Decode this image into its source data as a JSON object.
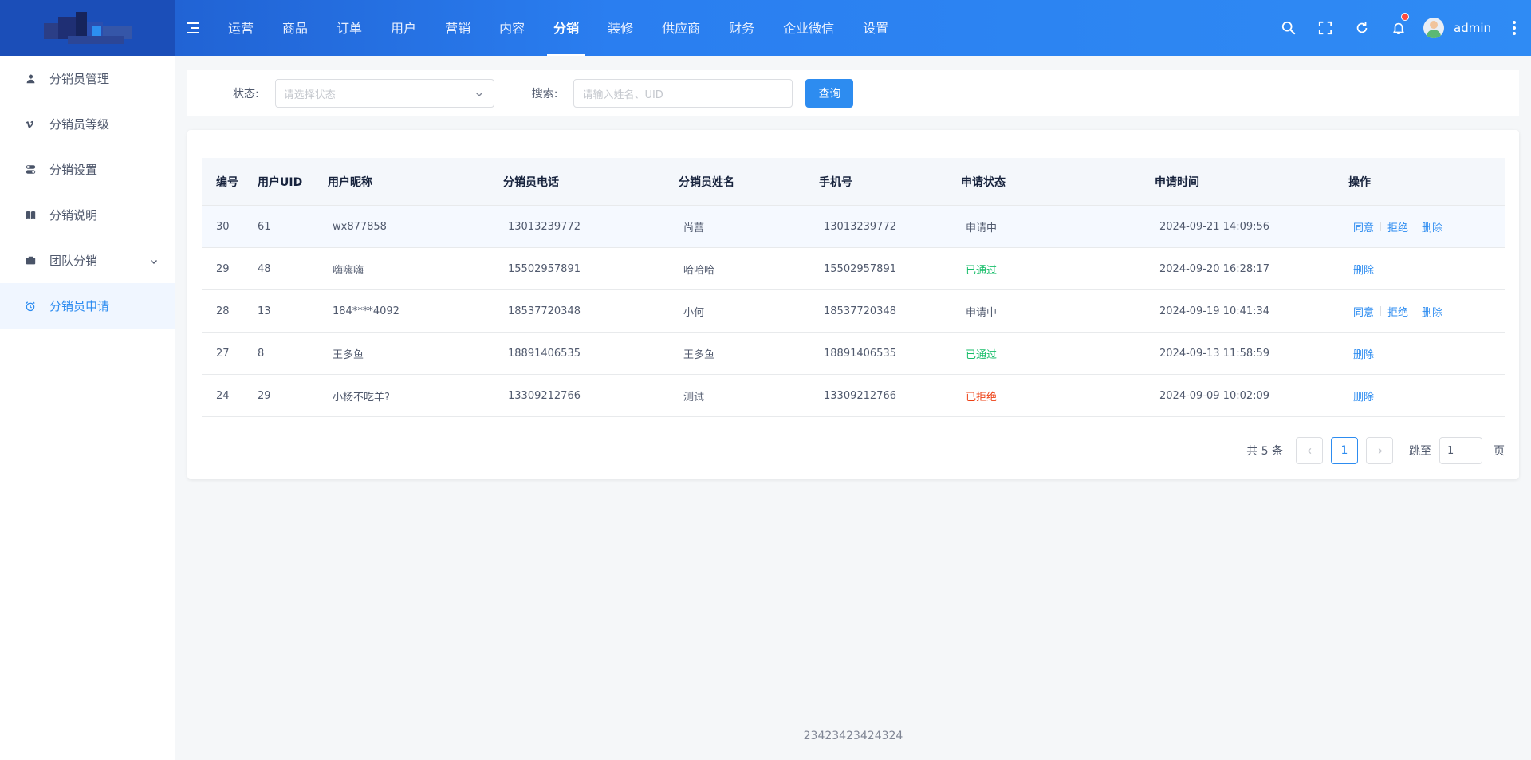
{
  "header": {
    "nav": [
      "运营",
      "商品",
      "订单",
      "用户",
      "营销",
      "内容",
      "分销",
      "装修",
      "供应商",
      "财务",
      "企业微信",
      "设置"
    ],
    "active_nav": "分销",
    "username": "admin"
  },
  "sidebar": {
    "items": [
      {
        "label": "分销员管理",
        "icon": "user-icon"
      },
      {
        "label": "分销员等级",
        "icon": "vimeo-v-icon"
      },
      {
        "label": "分销设置",
        "icon": "toggle-icon"
      },
      {
        "label": "分销说明",
        "icon": "book-icon"
      },
      {
        "label": "团队分销",
        "icon": "briefcase-icon"
      },
      {
        "label": "分销员申请",
        "icon": "alarm-clock-icon"
      }
    ],
    "active": "分销员申请"
  },
  "filter": {
    "status_label": "状态:",
    "status_placeholder": "请选择状态",
    "search_label": "搜索:",
    "search_placeholder": "请输入姓名、UID",
    "query_button": "查询"
  },
  "table": {
    "columns": [
      "编号",
      "用户UID",
      "用户昵称",
      "分销员电话",
      "分销员姓名",
      "手机号",
      "申请状态",
      "申请时间",
      "操作"
    ],
    "rows": [
      {
        "id": "30",
        "uid": "61",
        "nickname": "wx877858",
        "dist_phone": "13013239772",
        "name": "尚蕾",
        "mobile": "13013239772",
        "status": "申请中",
        "time": "2024-09-21 14:09:56"
      },
      {
        "id": "29",
        "uid": "48",
        "nickname": "嗨嗨嗨",
        "dist_phone": "15502957891",
        "name": "哈哈哈",
        "mobile": "15502957891",
        "status": "已通过",
        "time": "2024-09-20 16:28:17"
      },
      {
        "id": "28",
        "uid": "13",
        "nickname": "184****4092",
        "dist_phone": "18537720348",
        "name": "小何",
        "mobile": "18537720348",
        "status": "申请中",
        "time": "2024-09-19 10:41:34"
      },
      {
        "id": "27",
        "uid": "8",
        "nickname": "王多鱼",
        "dist_phone": "18891406535",
        "name": "王多鱼",
        "mobile": "18891406535",
        "status": "已通过",
        "time": "2024-09-13 11:58:59"
      },
      {
        "id": "24",
        "uid": "29",
        "nickname": "小杨不吃羊?",
        "dist_phone": "13309212766",
        "name": "测试",
        "mobile": "13309212766",
        "status": "已拒绝",
        "time": "2024-09-09 10:02:09"
      }
    ],
    "actions": {
      "agree": "同意",
      "reject": "拒绝",
      "delete": "删除"
    }
  },
  "pagination": {
    "total_text": "共 5 条",
    "current_page": "1",
    "jump_label": "跳至",
    "jump_value": "1",
    "page_suffix": "页"
  },
  "footer": {
    "text": "23423423424324"
  },
  "colors": {
    "primary": "#2d8cf0",
    "success": "#19be6b",
    "error": "#ed4014"
  }
}
